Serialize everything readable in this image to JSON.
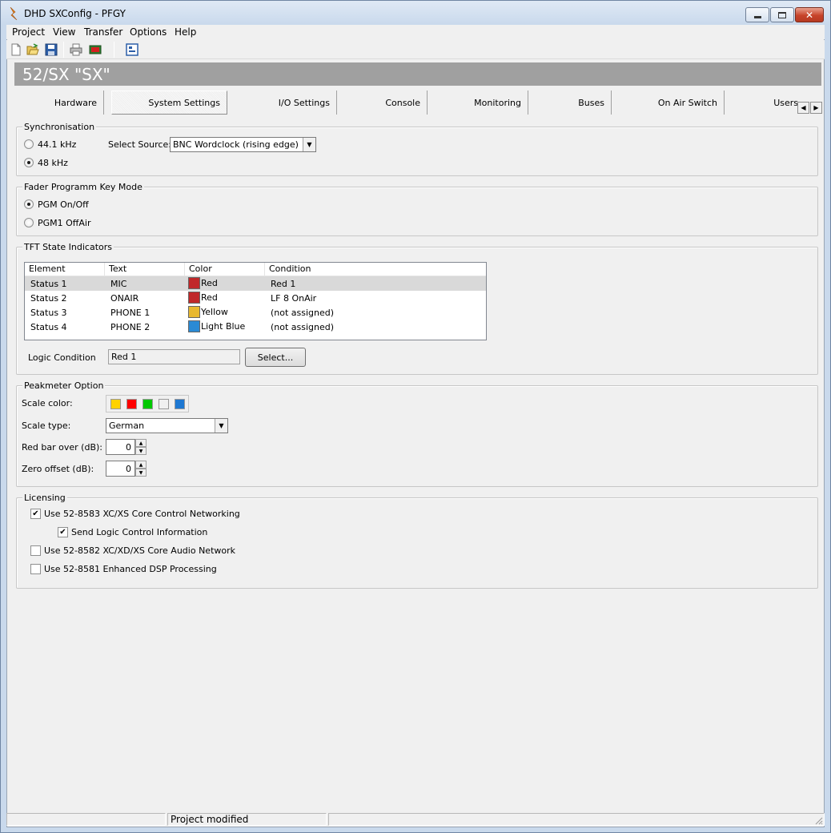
{
  "window": {
    "title": "DHD SXConfig - PFGY"
  },
  "menu": [
    "Project",
    "View",
    "Transfer",
    "Options",
    "Help"
  ],
  "toolbar": {
    "buttons": [
      "new-file-icon",
      "open-folder-icon",
      "save-icon",
      "print-icon",
      "device-icon",
      "properties-icon"
    ]
  },
  "header": {
    "title": "52/SX \"SX\""
  },
  "tabs": [
    "Hardware",
    "System Settings",
    "I/O Settings",
    "Console",
    "Monitoring",
    "Buses",
    "On Air Switch",
    "Users"
  ],
  "synchronisation": {
    "legend": "Synchronisation",
    "opt_44": "44.1 kHz",
    "opt_48": "48 kHz",
    "selected": "48 kHz",
    "source_label": "Select Source:",
    "source_value": "BNC Wordclock (rising edge)"
  },
  "fader": {
    "legend": "Fader Programm Key Mode",
    "opt1": "PGM On/Off",
    "opt2": "PGM1 OffAir",
    "selected": "PGM On/Off"
  },
  "tft": {
    "legend": "TFT State Indicators",
    "columns": [
      "Element",
      "Text",
      "Color",
      "Condition"
    ],
    "rows": [
      {
        "element": "Status 1",
        "text": "MIC",
        "color": "Red",
        "swatch": "#c0282a",
        "condition": "Red 1"
      },
      {
        "element": "Status 2",
        "text": "ONAIR",
        "color": "Red",
        "swatch": "#c0282a",
        "condition": "LF 8 OnAir"
      },
      {
        "element": "Status 3",
        "text": "PHONE 1",
        "color": "Yellow",
        "swatch": "#e8b830",
        "condition": "(not assigned)"
      },
      {
        "element": "Status 4",
        "text": "PHONE 2",
        "color": "Light Blue",
        "swatch": "#2a8ad4",
        "condition": "(not assigned)"
      }
    ],
    "selected_row": 0,
    "logic_label": "Logic Condition",
    "logic_value": "Red 1",
    "select_button": "Select..."
  },
  "peakmeter": {
    "legend": "Peakmeter Option",
    "scale_color_label": "Scale color:",
    "scale_colors": [
      "#ffd200",
      "#ff0000",
      "#00c800",
      "#f0f0f0",
      "#1e78d2"
    ],
    "scale_type_label": "Scale type:",
    "scale_type_value": "German",
    "red_bar_label": "Red bar over (dB):",
    "red_bar_value": "0",
    "zero_offset_label": "Zero offset (dB):",
    "zero_offset_value": "0"
  },
  "licensing": {
    "legend": "Licensing",
    "items": [
      {
        "label": "Use 52-8583 XC/XS Core Control Networking",
        "checked": true
      },
      {
        "label": "Send Logic Control Information",
        "checked": true
      },
      {
        "label": "Use 52-8582 XC/XD/XS Core Audio Network",
        "checked": false
      },
      {
        "label": "Use 52-8581 Enhanced DSP Processing",
        "checked": false
      }
    ]
  },
  "statusbar": {
    "panels": [
      "",
      "Project modified",
      ""
    ]
  }
}
